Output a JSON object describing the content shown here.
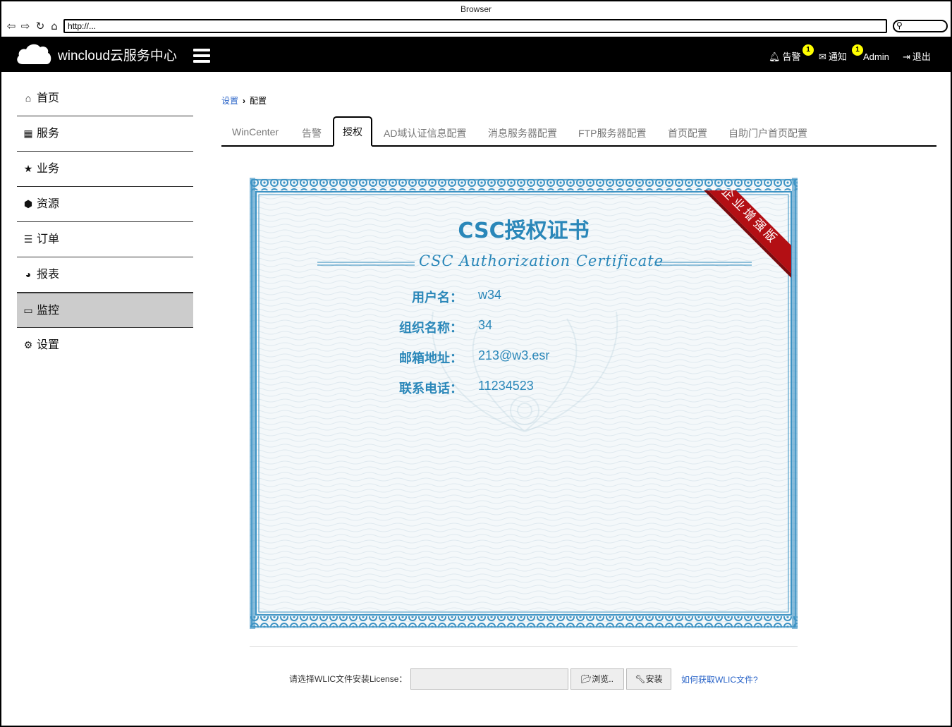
{
  "browser": {
    "title": "Browser",
    "url": "http://..."
  },
  "header": {
    "brand": "wincloud云服务中心",
    "alerts_label": "告警",
    "alerts_count": "1",
    "notices_label": "通知",
    "notices_count": "1",
    "user": "Admin",
    "logout_label": "退出"
  },
  "sidebar": {
    "items": [
      {
        "label": "首页",
        "icon": "home-icon"
      },
      {
        "label": "服务",
        "icon": "grid-icon"
      },
      {
        "label": "业务",
        "icon": "star-icon"
      },
      {
        "label": "资源",
        "icon": "cube-icon"
      },
      {
        "label": "订单",
        "icon": "list-icon"
      },
      {
        "label": "报表",
        "icon": "pie-chart-icon"
      },
      {
        "label": "监控",
        "icon": "monitor-icon"
      },
      {
        "label": "设置",
        "icon": "gear-icon"
      }
    ],
    "active_index": 6
  },
  "breadcrumb": {
    "parent": "设置",
    "current": "配置"
  },
  "tabs": [
    "WinCenter",
    "告警",
    "授权",
    "AD域认证信息配置",
    "消息服务器配置",
    "FTP服务器配置",
    "首页配置",
    "自助门户首页配置"
  ],
  "active_tab": "授权",
  "certificate": {
    "title": "CSC授权证书",
    "subtitle": "CSC  Authorization  Certificate",
    "ribbon": "企业增强版",
    "fields": [
      {
        "label": "用户名：",
        "value": "w34"
      },
      {
        "label": "组织名称：",
        "value": "34"
      },
      {
        "label": "邮箱地址：",
        "value": "213@w3.esr"
      },
      {
        "label": "联系电话：",
        "value": "11234523"
      }
    ]
  },
  "license": {
    "label": "请选择WLIC文件安装License：",
    "input_value": "",
    "browse_label": "浏览..",
    "install_label": "安装",
    "help_link": "如何获取WLIC文件?"
  },
  "colors": {
    "accent": "#2a87b9",
    "ribbon": "#b30f14",
    "link": "#2a64c8"
  }
}
